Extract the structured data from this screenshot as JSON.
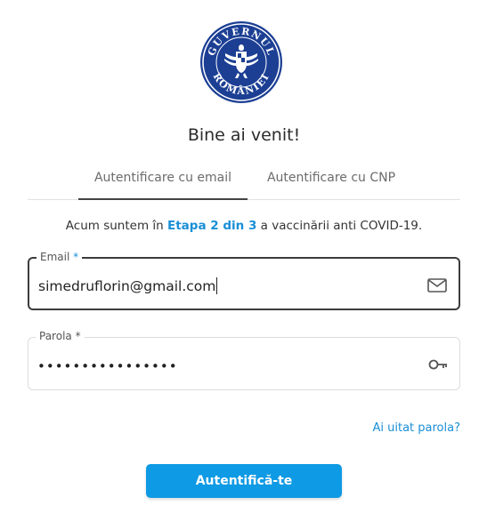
{
  "logo": {
    "arc_top": "GUVERNUL",
    "arc_bottom": "ROMÂNIEI",
    "color": "#1c3f94"
  },
  "welcome": "Bine ai venit!",
  "tabs": [
    {
      "label": "Autentificare cu email",
      "active": true
    },
    {
      "label": "Autentificare cu CNP",
      "active": false
    }
  ],
  "stage": {
    "before": "Acum suntem în ",
    "highlight": "Etapa 2 din 3",
    "after": " a vaccinării anti COVID-19."
  },
  "email": {
    "label": "Email",
    "required_mark": "*",
    "value": "simedruflorin@gmail.com",
    "icon": "envelope-icon"
  },
  "password": {
    "label": "Parola",
    "required_mark": "*",
    "value": "••••••••••••••••",
    "icon": "key-icon"
  },
  "forgot_link": "Ai uitat parola?",
  "submit_label": "Autentifică-te",
  "colors": {
    "accent": "#1a8fd6",
    "button": "#0e9ae4",
    "logo": "#1c3f94"
  }
}
